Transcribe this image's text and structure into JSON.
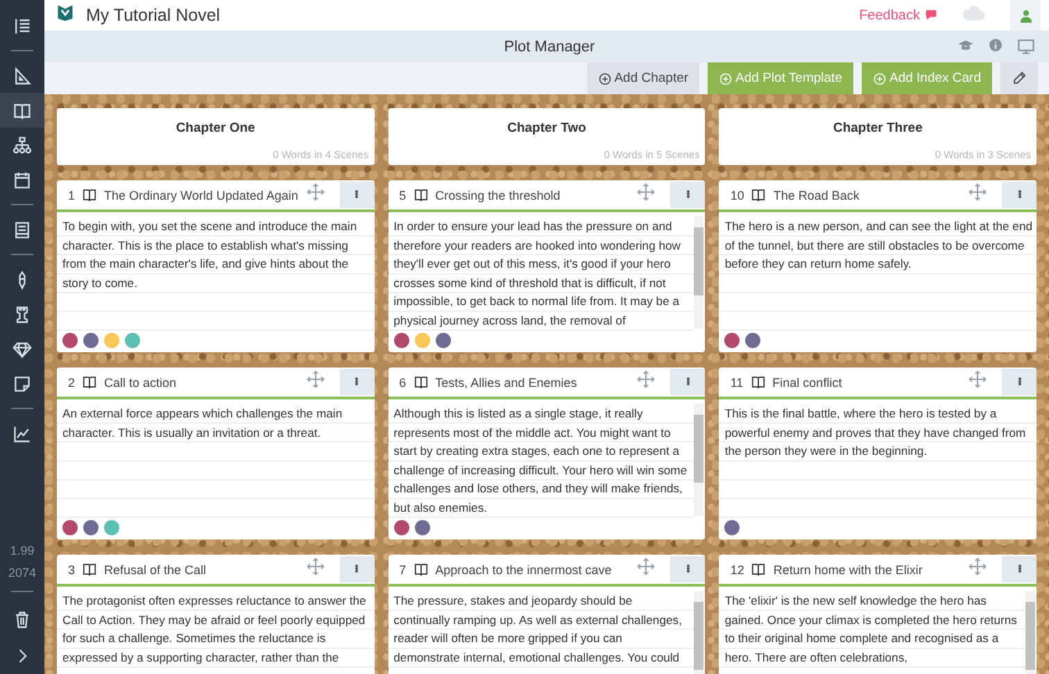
{
  "app": {
    "title": "My Tutorial Novel",
    "feedback": "Feedback"
  },
  "sidebar": {
    "groups": [
      [
        {
          "kind": "outline",
          "selected": false
        }
      ],
      [
        {
          "kind": "ruler",
          "selected": false
        },
        {
          "kind": "book",
          "selected": true
        },
        {
          "kind": "sitemap",
          "selected": false
        },
        {
          "kind": "calendar",
          "selected": false
        }
      ],
      [
        {
          "kind": "notebook",
          "selected": false
        }
      ],
      [
        {
          "kind": "pen",
          "selected": false
        },
        {
          "kind": "tower",
          "selected": false
        },
        {
          "kind": "diamond",
          "selected": false
        },
        {
          "kind": "note",
          "selected": false
        }
      ],
      [
        {
          "kind": "chart",
          "selected": false
        }
      ]
    ],
    "version": [
      "1.99",
      "2074"
    ]
  },
  "titlebar": {
    "title": "Plot Manager"
  },
  "toolbar": {
    "buttons": [
      {
        "label": "Add Chapter",
        "kind": "plain"
      },
      {
        "label": "Add Plot Template",
        "kind": "primary"
      },
      {
        "label": "Add Index Card",
        "kind": "primary"
      }
    ]
  },
  "chapters": [
    {
      "title": "Chapter One",
      "summary": "0 Words in 4 Scenes",
      "cards": [
        {
          "number": "1",
          "title": "The Ordinary World Updated Again",
          "text": "To begin with, you set the scene and introduce the main character. This is the place to establish what's missing from the main character's life, and give hints about the story to come.",
          "scrollable": false,
          "tags": [
            {
              "color": "#b24a6e"
            },
            {
              "color": "#6e6c92"
            },
            {
              "color": "#f5c857"
            },
            {
              "color": "#5bbfb1"
            }
          ]
        },
        {
          "number": "2",
          "title": "Call to action",
          "text": "An external force appears which challenges the main character. This is usually an invitation or a threat.",
          "scrollable": false,
          "tags": [
            {
              "color": "#b24a6e"
            },
            {
              "color": "#6e6c92"
            },
            {
              "color": "#5bbfb1"
            }
          ]
        },
        {
          "number": "3",
          "title": "Refusal of the Call",
          "text": "The protagonist often expresses reluctance to answer the Call to Action. They may be afraid or feel poorly equipped for such a challenge. Sometimes the reluctance is expressed by a supporting character, rather than the",
          "scrollable": false
        }
      ]
    },
    {
      "title": "Chapter Two",
      "summary": "0 Words in 5 Scenes",
      "cards": [
        {
          "number": "5",
          "title": "Crossing the threshold",
          "text": "In order to ensure your lead has the pressure on and therefore your readers are hooked into wondering how they'll ever get out of this mess, it's good if your hero crosses some kind of threshold that is difficult, if not impossible, to get back to normal life from. It may be a physical journey across land, the removal of",
          "scrollable": true,
          "tags": [
            {
              "color": "#b24a6e"
            },
            {
              "color": "#f5c857"
            },
            {
              "color": "#6e6c92"
            }
          ]
        },
        {
          "number": "6",
          "title": "Tests, Allies and Enemies",
          "text": "Although this is listed as a single stage, it really represents most of the middle act. You might want to start by creating extra stages, each one to represent a challenge of increasing difficult. Your hero will win some challenges and lose others, and they will make friends, but also enemies.",
          "scrollable": true,
          "tags": [
            {
              "color": "#b24a6e"
            },
            {
              "color": "#6e6c92"
            }
          ]
        },
        {
          "number": "7",
          "title": "Approach to the innermost cave",
          "text": "The pressure, stakes and jeopardy should be continually ramping up. As well as external challenges, reader will often be more gripped if you can demonstrate internal, emotional challenges. You could",
          "scrollable": true
        }
      ]
    },
    {
      "title": "Chapter Three",
      "summary": "0 Words in 3 Scenes",
      "cards": [
        {
          "number": "10",
          "title": "The Road Back",
          "text": "The hero is a new person, and can see the light at the end of the tunnel, but there are still obstacles to be overcome before they can return home safely.",
          "scrollable": false,
          "tags": [
            {
              "color": "#b24a6e"
            },
            {
              "color": "#6e6c92"
            }
          ]
        },
        {
          "number": "11",
          "title": "Final conflict",
          "text": "This is the final battle, where the hero is tested by a powerful enemy and proves that they have changed from the person they were in the beginning.",
          "scrollable": false,
          "tags": [
            {
              "color": "#6e6c92"
            }
          ]
        },
        {
          "number": "12",
          "title": "Return home with the Elixir",
          "text": "The 'elixir' is the new self knowledge the hero has gained. Once your climax is completed the hero returns to their original home complete and recognised as a hero. There are often celebrations,",
          "scrollable": true
        }
      ]
    }
  ]
}
